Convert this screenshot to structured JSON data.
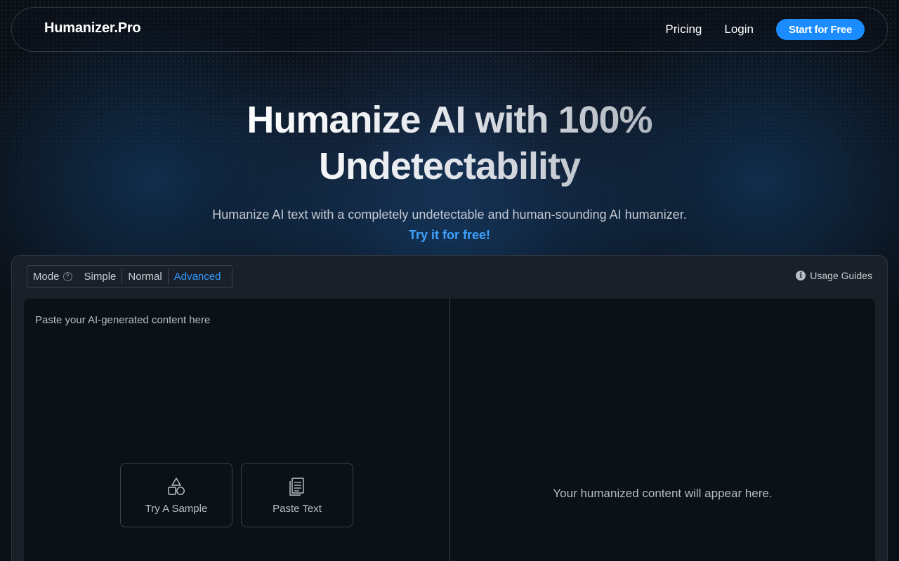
{
  "nav": {
    "logo": "Humanizer.Pro",
    "links": [
      "Pricing",
      "Login"
    ],
    "cta": "Start for Free"
  },
  "hero": {
    "title": "Humanize AI with 100% Undetectability",
    "subtitle": "Humanize AI text with a completely undetectable and human-sounding AI humanizer.",
    "cta": "Try it for free!"
  },
  "mode": {
    "label": "Mode",
    "options": [
      "Simple",
      "Normal",
      "Advanced"
    ],
    "selected": "Advanced"
  },
  "guides": {
    "label": "Usage Guides"
  },
  "input": {
    "placeholder": "Paste your AI-generated content here",
    "buttons": [
      {
        "label": "Try A Sample",
        "icon": "shapes-icon"
      },
      {
        "label": "Paste Text",
        "icon": "document-icon"
      }
    ]
  },
  "output": {
    "placeholder": "Your humanized content will appear here."
  },
  "colors": {
    "accent": "#1a8cff",
    "link": "#3fa2ff",
    "active_mode": "#2f9bff",
    "panel": "#1a1f28",
    "editor": "#0c1118"
  }
}
